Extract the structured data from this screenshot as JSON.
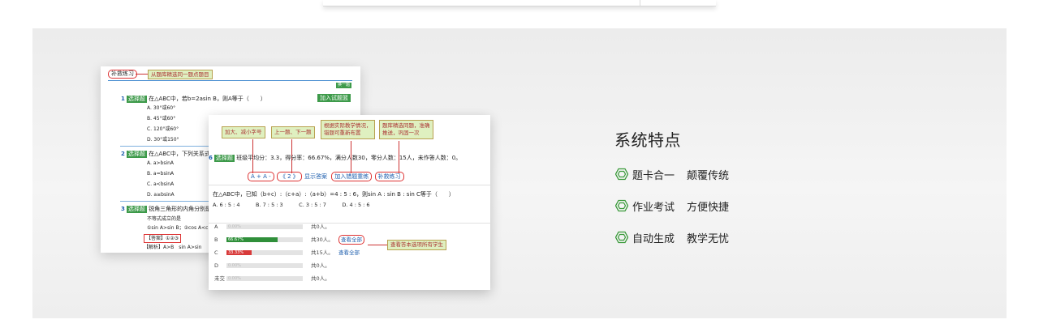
{
  "features": {
    "title": "系统特点",
    "items": [
      {
        "a": "题卡合一",
        "b": "颠覆传统"
      },
      {
        "a": "作业考试",
        "b": "方便快捷"
      },
      {
        "a": "自动生成",
        "b": "教学无忧"
      }
    ],
    "icon": "hexagon-bullet-icon",
    "accent": "#3a9a3a"
  },
  "shot1": {
    "title": "补救练习",
    "callout": "从题库精选同一题点题目",
    "top_button": "换一题",
    "add_button": "加入试题篮",
    "tag": "选择题",
    "q1": {
      "num": "1",
      "text": "在△ABC中，若b=2asin B，则A等于（　　）",
      "options": [
        "A. 30°或60°",
        "B. 45°或60°",
        "C. 120°或60°",
        "D. 30°或150°"
      ]
    },
    "q2": {
      "num": "2",
      "text": "在△ABC中，下列关系式",
      "options": [
        "A. a>bsinA",
        "B. a=bsinA",
        "C. a<bsinA",
        "D. a≥bsinA"
      ]
    },
    "q3": {
      "num": "3",
      "text": "锐角三角形的内角分别是",
      "lines": [
        "不等式成立的是",
        "①sin A>sin B；②cos A<c",
        "【答案】①②③",
        "【解析】A>B　sin A>sin"
      ]
    }
  },
  "shot2": {
    "callouts": {
      "c1": "加大、减小字号",
      "c2": "上一题、下一题",
      "c3a": "根据实际教学情况，",
      "c3b": "错题可重新布置",
      "c4a": "题库精选同题，准确",
      "c4b": "推送，巩固一次",
      "c5": "查看答本选项所有学生"
    },
    "qnum": "6",
    "tag": "选择题",
    "stats": "班级平均分：3.3，得分率：66.67%，满分人数30，零分人数：15人，未作答人数：0。",
    "font_ctrl": "A + A -",
    "nav_ctrl": "《 2 》",
    "show_answer": "显示答案",
    "redo_button": "加入错题重练",
    "practice_button": "补救练习",
    "question": "在△ABC中，已知（b+c）:（c+a）:（a+b）=4 : 5 : 6，则sin A : sin B : sin C等于（　　）",
    "choices": "A. 6 : 5 : 4　　　B. 7 : 5 : 3　　　C. 3 : 5 : 7　　　D. 4 : 5 : 6",
    "view_all": "查看全部",
    "rows": [
      {
        "label": "A",
        "pct": "0.00%",
        "fraction": 0,
        "count": "共0人。",
        "color": "#2f8f3a",
        "view": false
      },
      {
        "label": "B",
        "pct": "66.67%",
        "fraction": 0.6667,
        "count": "共30人。",
        "color": "#2f8f3a",
        "view": true
      },
      {
        "label": "C",
        "pct": "33.33%",
        "fraction": 0.3333,
        "count": "共15人。",
        "color": "#d83a3a",
        "view": true
      },
      {
        "label": "D",
        "pct": "0.00%",
        "fraction": 0,
        "count": "共0人。",
        "color": "#2f8f3a",
        "view": false
      },
      {
        "label": "未交",
        "pct": "0.00%",
        "fraction": 0,
        "count": "共0人。",
        "color": "#2f8f3a",
        "view": false
      }
    ]
  }
}
